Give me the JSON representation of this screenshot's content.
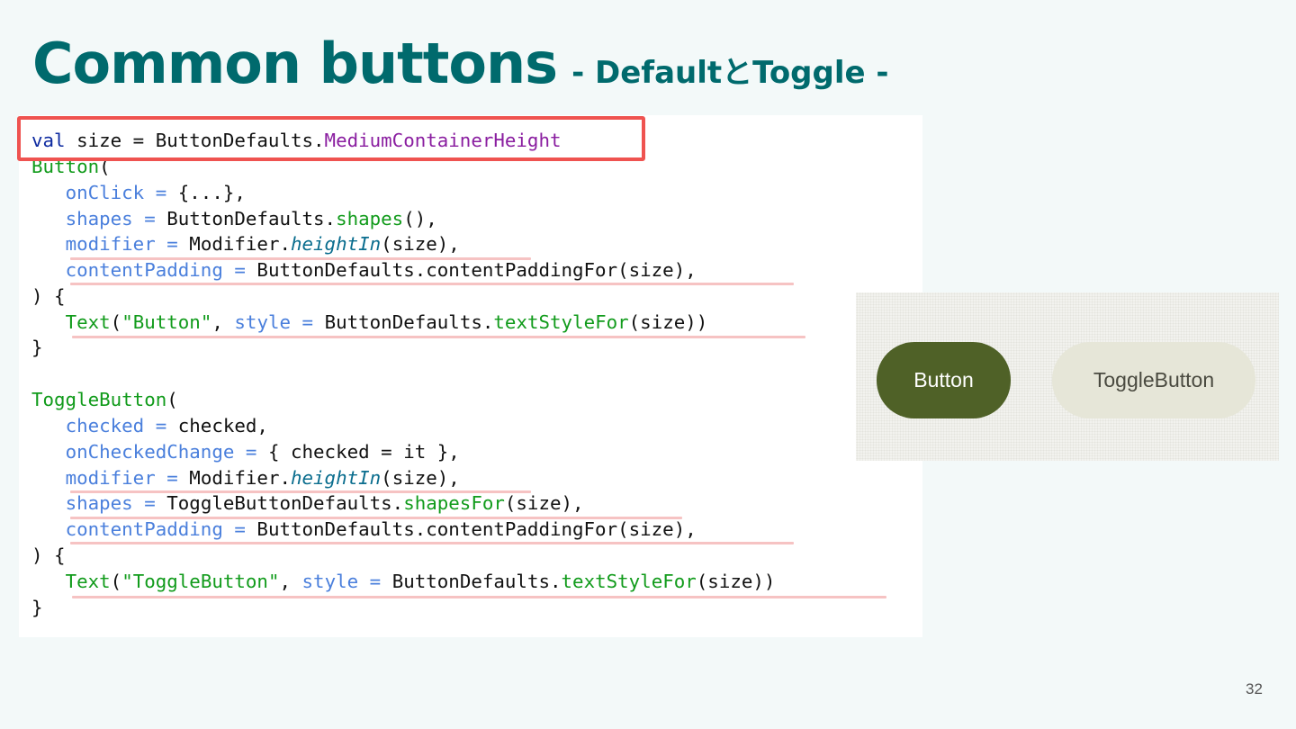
{
  "slide": {
    "title": "Common buttons",
    "subtitle": "- DefaultとToggle -",
    "page_number": "32"
  },
  "preview": {
    "button_label": "Button",
    "toggle_button_label": "ToggleButton"
  },
  "code": {
    "l1": {
      "kw": "val",
      "a": " size = ButtonDefaults.",
      "prop": "MediumContainerHeight"
    },
    "l2": {
      "fn": "Button",
      "b": "("
    },
    "l3": {
      "par": "onClick =",
      "b": " {...},"
    },
    "l4": {
      "par": "shapes =",
      "b": " ButtonDefaults.",
      "fn": "shapes",
      "c": "(),"
    },
    "l5": {
      "par": "modifier =",
      "b": " Modifier.",
      "ital": "heightIn",
      "c": "(size),"
    },
    "l6": {
      "par": "contentPadding =",
      "b": " ButtonDefaults.contentPaddingFor(size),"
    },
    "l7": {
      "a": ") {"
    },
    "l8": {
      "fn": "Text",
      "b": "(",
      "str": "\"Button\"",
      "c": ", ",
      "par": "style =",
      "d": " ButtonDefaults.",
      "fn2": "textStyleFor",
      "e": "(size))"
    },
    "l9": {
      "a": "}"
    },
    "l10": {
      "fn": "ToggleButton",
      "b": "("
    },
    "l11": {
      "par": "checked =",
      "b": " checked,"
    },
    "l12": {
      "par": "onCheckedChange =",
      "b": " { checked = it },"
    },
    "l13": {
      "par": "modifier =",
      "b": " Modifier.",
      "ital": "heightIn",
      "c": "(size),"
    },
    "l14": {
      "par": "shapes =",
      "b": " ToggleButtonDefaults.",
      "fn": "shapesFor",
      "c": "(size),"
    },
    "l15": {
      "par": "contentPadding =",
      "b": " ButtonDefaults.contentPaddingFor(size),"
    },
    "l16": {
      "a": ") {"
    },
    "l17": {
      "fn": "Text",
      "b": "(",
      "str": "\"ToggleButton\"",
      "c": ", ",
      "par": "style =",
      "d": " ButtonDefaults.",
      "fn2": "textStyleFor",
      "e": "(size))"
    },
    "l18": {
      "a": "}"
    }
  },
  "colors": {
    "title": "#006a6d",
    "keyword": "#0d2aa0",
    "function": "#119b1b",
    "parameter": "#4a7fdc",
    "property": "#8a1ea0",
    "highlight_box": "#ef5350",
    "underline": "#f6c3c3",
    "button_fill": "#4f6127",
    "toggle_fill": "#e6e6d8"
  }
}
